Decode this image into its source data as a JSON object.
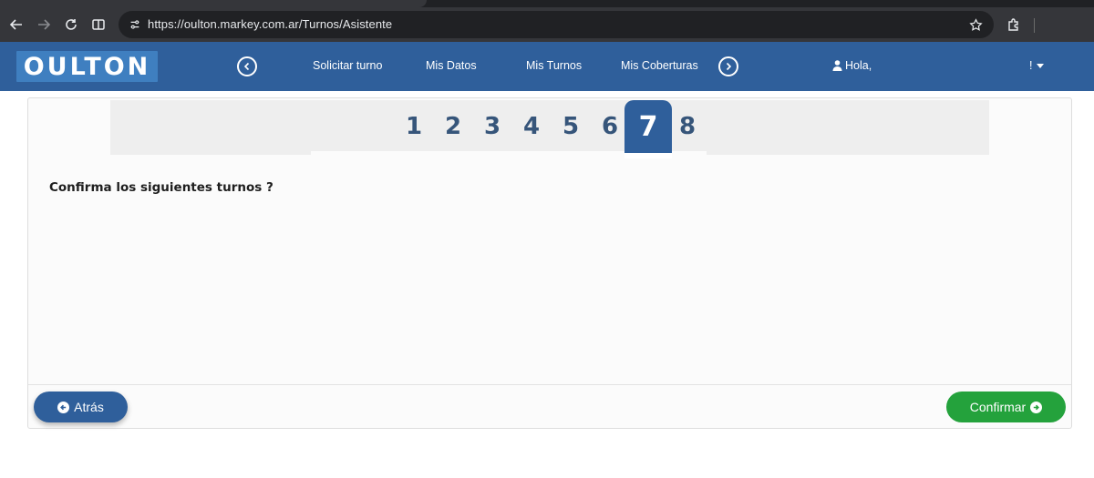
{
  "browser": {
    "url": "https://oulton.markey.com.ar/Turnos/Asistente"
  },
  "header": {
    "logo_text": "OULTON",
    "nav": [
      "Solicitar turno",
      "Mis Datos",
      "Mis Turnos",
      "Mis Coberturas"
    ],
    "greeting": "Hola,",
    "user_menu": "!"
  },
  "wizard": {
    "steps": [
      "1",
      "2",
      "3",
      "4",
      "5",
      "6",
      "7",
      "8"
    ],
    "current_step": "7",
    "question": "Confirma los siguientes turnos ?",
    "back_label": "Atrás",
    "confirm_label": "Confirmar"
  },
  "colors": {
    "header_bg": "#2f5f9b",
    "logo_bg": "#3f7fc0",
    "confirm_green": "#24a23c",
    "step_text": "#36557a"
  }
}
